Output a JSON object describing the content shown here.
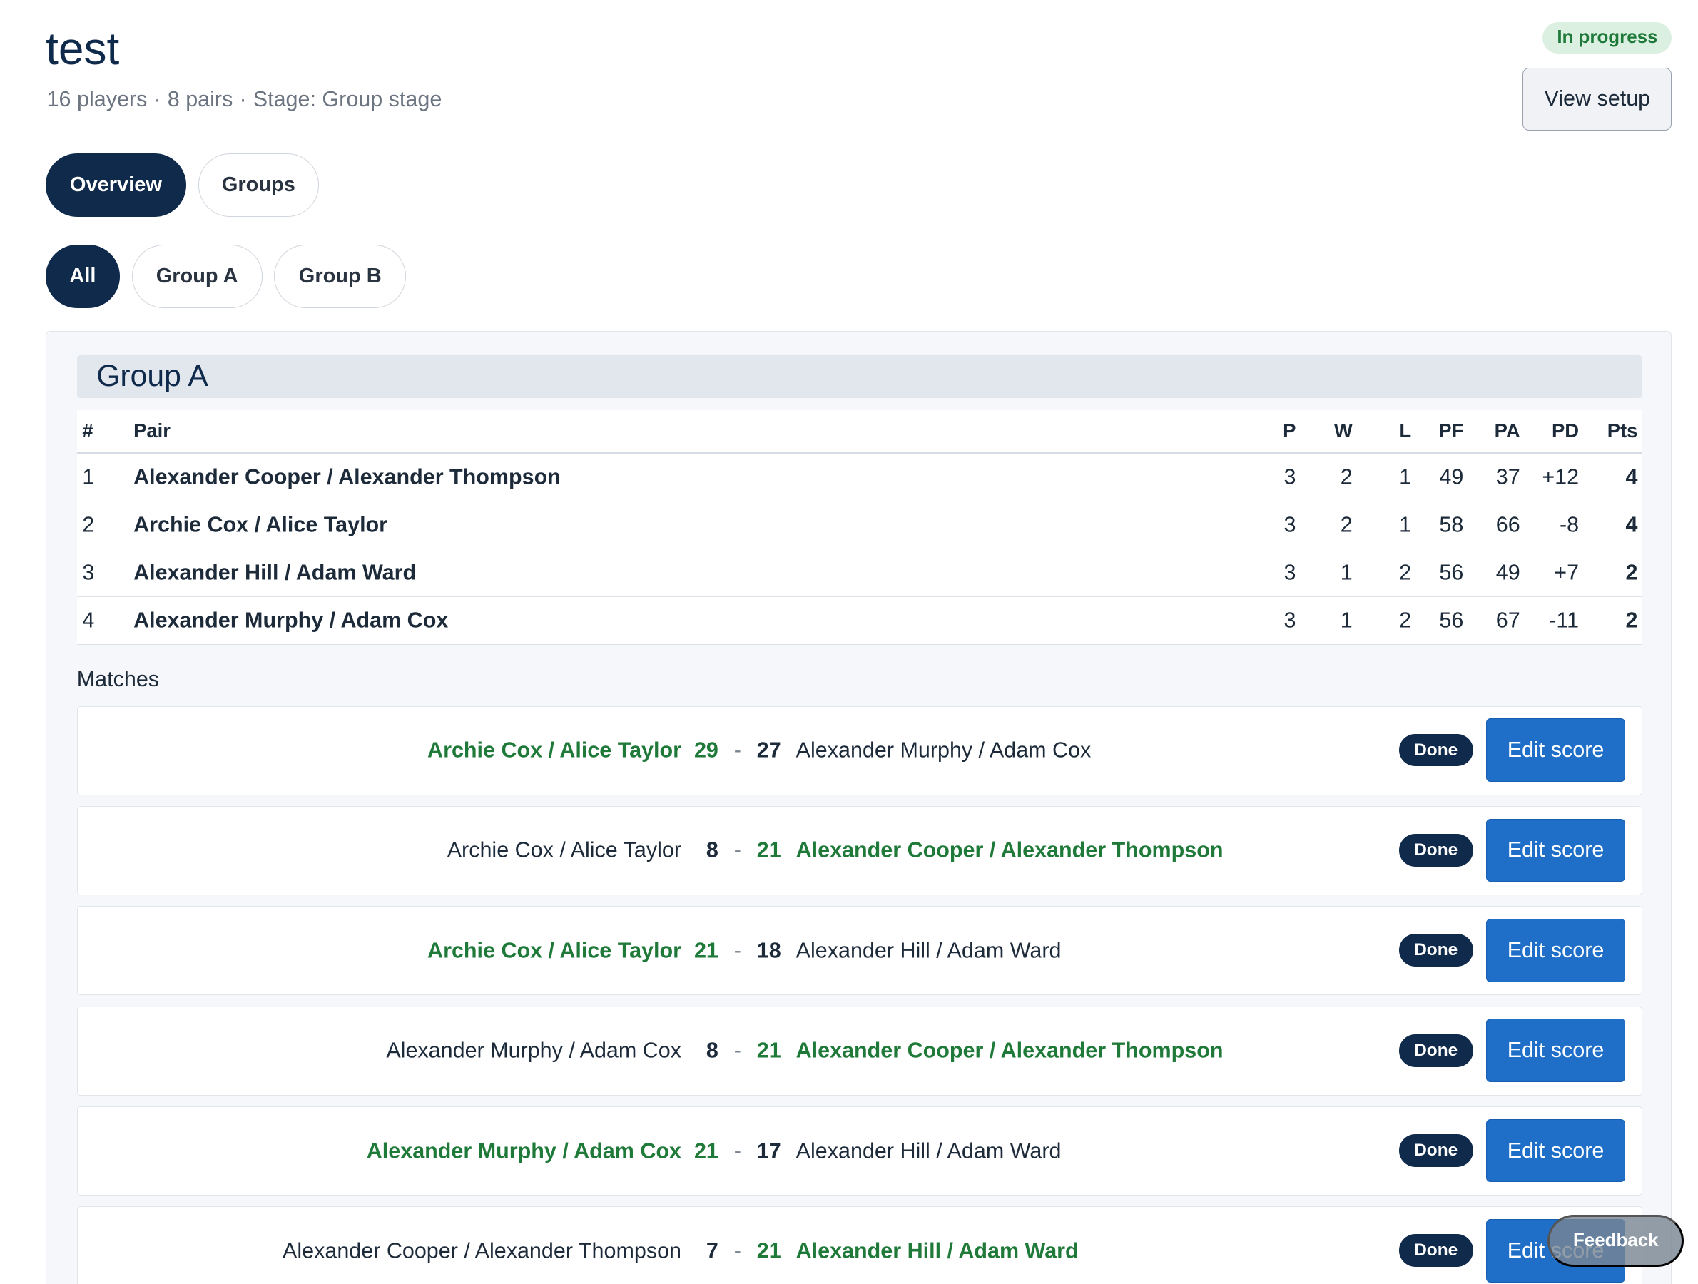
{
  "header": {
    "title": "test",
    "players": "16 players",
    "pairs": "8 pairs",
    "stage": "Stage: Group stage",
    "separator": "·",
    "status": "In progress",
    "view_setup_label": "View setup"
  },
  "tabs": [
    {
      "label": "Overview",
      "active": true
    },
    {
      "label": "Groups",
      "active": false
    }
  ],
  "filters": [
    {
      "label": "All",
      "active": true
    },
    {
      "label": "Group A",
      "active": false
    },
    {
      "label": "Group B",
      "active": false
    }
  ],
  "group": {
    "name": "Group A",
    "columns": {
      "rank": "#",
      "pair": "Pair",
      "p": "P",
      "w": "W",
      "l": "L",
      "pf": "PF",
      "pa": "PA",
      "pd": "PD",
      "pts": "Pts"
    },
    "standings": [
      {
        "rank": "1",
        "pair": "Alexander Cooper / Alexander Thompson",
        "p": "3",
        "w": "2",
        "l": "1",
        "pf": "49",
        "pa": "37",
        "pd": "+12",
        "pts": "4"
      },
      {
        "rank": "2",
        "pair": "Archie Cox / Alice Taylor",
        "p": "3",
        "w": "2",
        "l": "1",
        "pf": "58",
        "pa": "66",
        "pd": "-8",
        "pts": "4"
      },
      {
        "rank": "3",
        "pair": "Alexander Hill / Adam Ward",
        "p": "3",
        "w": "1",
        "l": "2",
        "pf": "56",
        "pa": "49",
        "pd": "+7",
        "pts": "2"
      },
      {
        "rank": "4",
        "pair": "Alexander Murphy / Adam Cox",
        "p": "3",
        "w": "1",
        "l": "2",
        "pf": "56",
        "pa": "67",
        "pd": "-11",
        "pts": "2"
      }
    ],
    "matches_label": "Matches",
    "matches": [
      {
        "pair1": "Archie Cox / Alice Taylor",
        "score1": "29",
        "score2": "27",
        "pair2": "Alexander Murphy / Adam Cox",
        "winner": 1,
        "status": "Done",
        "action": "Edit score"
      },
      {
        "pair1": "Archie Cox / Alice Taylor",
        "score1": "8",
        "score2": "21",
        "pair2": "Alexander Cooper / Alexander Thompson",
        "winner": 2,
        "status": "Done",
        "action": "Edit score"
      },
      {
        "pair1": "Archie Cox / Alice Taylor",
        "score1": "21",
        "score2": "18",
        "pair2": "Alexander Hill / Adam Ward",
        "winner": 1,
        "status": "Done",
        "action": "Edit score"
      },
      {
        "pair1": "Alexander Murphy / Adam Cox",
        "score1": "8",
        "score2": "21",
        "pair2": "Alexander Cooper / Alexander Thompson",
        "winner": 2,
        "status": "Done",
        "action": "Edit score"
      },
      {
        "pair1": "Alexander Murphy / Adam Cox",
        "score1": "21",
        "score2": "17",
        "pair2": "Alexander Hill / Adam Ward",
        "winner": 1,
        "status": "Done",
        "action": "Edit score"
      },
      {
        "pair1": "Alexander Cooper / Alexander Thompson",
        "score1": "7",
        "score2": "21",
        "pair2": "Alexander Hill / Adam Ward",
        "winner": 2,
        "status": "Done",
        "action": "Edit score"
      }
    ],
    "score_separator": "-"
  },
  "feedback_label": "Feedback",
  "colors": {
    "navy": "#0f2a4a",
    "win_green": "#1f7a3a",
    "button_blue": "#1f6fc8",
    "badge_bg": "#dcf0e2"
  }
}
